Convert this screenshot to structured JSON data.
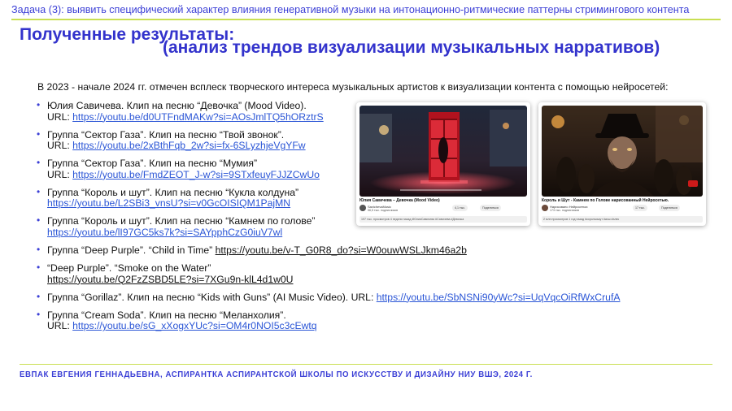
{
  "header": {
    "task": "Задача (3): выявить специфический характер влияния генеративной музыки на интонационно-ритмические паттерны стримингового контента",
    "title_line1": "Полученные результаты:",
    "title_line2": "(анализ трендов визуализации музыкальных нарративов)"
  },
  "intro": "В 2023 - начале 2024 гг. отмечен всплеск творческого интереса музыкальных артистов к визуализации контента с помощью нейросетей:",
  "items": [
    {
      "text": "Юлия Савичева. Клип на песню “Девочка” (Mood Video).",
      "prefix": "URL: ",
      "url": "https://youtu.be/d0UTFndMAKw?si=AOsJmlTQ5hORztrS"
    },
    {
      "text": "Группа “Сектор Газа”. Клип на песню “Твой звонок”.",
      "prefix": "URL: ",
      "url": "https://youtu.be/2xBthFqb_2w?si=fx-6SLyzhjeVgYFw"
    },
    {
      "text": "Группа “Сектор Газа”. Клип на песню “Мумия”",
      "prefix": "URL: ",
      "url": "https://youtu.be/FmdZEOT_J-w?si=9STxfeuyFJJZCwUo"
    },
    {
      "text": "Группа “Король и шут”. Клип на песню “Кукла колдуна”",
      "prefix": "",
      "url": "https://youtu.be/L2SBi3_vnsU?si=v0GcOISIQM1PajMN"
    },
    {
      "text": "Группа “Король и шут”. Клип на песню “Камнем по голове”",
      "prefix": "",
      "url": "https://youtu.be/lI97GC5ks7k?si=SAYpphCzG0iuV7wl"
    },
    {
      "text": "Группа “Deep Purple”. “Child in Time” ",
      "url": "https://youtu.be/v-T_G0R8_do?si=W0ouwWSLJkm46a2b"
    },
    {
      "text": "“Deep Purple”. “Smoke on the Water”",
      "url": "https://youtu.be/Q2FzZSBD5LE?si=7XGu9n-klL4d1w0U"
    },
    {
      "text": "Группа “Gorillaz”. Клип на песню “Kids with Guns” (AI Music Video). URL: ",
      "url": "https://youtu.be/SbNSNi90yWc?si=UqVqcOiRfWxCrufA"
    },
    {
      "text": "Группа “Cream Soda”. Клип на песню “Меланхолия”.",
      "prefix": "URL: ",
      "url": "https://youtu.be/sG_xXogxYUc?si=OM4r0NOI5c3cEwtq"
    }
  ],
  "video1": {
    "title": "Юлия Савичева – Девочка (Mood Video)",
    "channel": "SavichevaMusic",
    "subs": "56,5 тыс. подписчиков",
    "views": "197 тыс. просмотров  4 недели назад  #ЮлияСавичева #Савичева #Девочка",
    "share": "Поделиться",
    "likes": "4,1 тыс."
  },
  "video2": {
    "title": "Король и Шут - Камнем по Голове нарисованный Нейросетью.",
    "channel": "Нарисовано Нейросетью",
    "subs": "173 тыс. подписчиков",
    "views": "2 млн просмотров  1 год назад  #корольишут #киш #алек",
    "share": "Поделиться",
    "likes": "17 тыс."
  },
  "footer": "ЕВПАК ЕВГЕНИЯ ГЕННАДЬЕВНА, АСПИРАНТКА АСПИРАНТСКОЙ ШКОЛЫ ПО ИСКУССТВУ И ДИЗАЙНУ НИУ ВШЭ, 2024 Г.",
  "colors": {
    "accent": "#3b3fd6",
    "title": "#3333cc",
    "link": "#2a55d6",
    "rule": "#c9df52"
  }
}
